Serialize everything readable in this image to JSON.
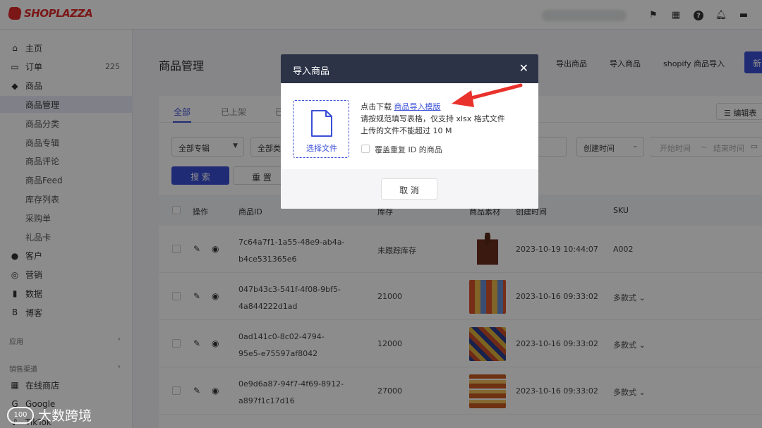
{
  "app": {
    "logo_text": "SHOPLAZZA"
  },
  "topbar": {
    "icons": [
      "flag-icon",
      "store-icon",
      "help-icon",
      "bell-icon",
      "message-icon"
    ]
  },
  "sidebar": {
    "items": [
      {
        "label": "主页",
        "icon": "home-icon"
      },
      {
        "label": "订单",
        "icon": "order-icon",
        "count": "225"
      },
      {
        "label": "商品",
        "icon": "tag-icon"
      },
      {
        "label": "商品管理",
        "sub": true,
        "active": true
      },
      {
        "label": "商品分类",
        "sub": true
      },
      {
        "label": "商品专辑",
        "sub": true
      },
      {
        "label": "商品评论",
        "sub": true
      },
      {
        "label": "商品Feed",
        "sub": true
      },
      {
        "label": "库存列表",
        "sub": true
      },
      {
        "label": "采购单",
        "sub": true
      },
      {
        "label": "礼品卡",
        "sub": true
      },
      {
        "label": "客户",
        "icon": "user-icon"
      },
      {
        "label": "营销",
        "icon": "marketing-icon"
      },
      {
        "label": "数据",
        "icon": "chart-icon"
      },
      {
        "label": "博客",
        "icon": "blog-icon"
      }
    ],
    "group_apps": "应用",
    "group_channels": "销售渠道",
    "channels": [
      {
        "label": "在线商店",
        "icon": "store-icon"
      },
      {
        "label": "Google",
        "icon": "google-icon"
      },
      {
        "label": "TikTok",
        "icon": "tiktok-icon"
      }
    ]
  },
  "main": {
    "title": "商品管理",
    "header_actions": [
      "导出商品",
      "导入商品",
      "shopify 商品导入"
    ],
    "new_button": "新",
    "tabs": [
      "全部",
      "已上架",
      "已"
    ],
    "edit_columns": "编辑表",
    "filters": {
      "album": "全部专辑",
      "category": "全部类",
      "sort": "创建时间",
      "start": "开始时间",
      "tilde": "~",
      "end": "结束时间"
    },
    "search": "搜 索",
    "reset": "重 置"
  },
  "table": {
    "headers": [
      "操作",
      "商品ID",
      "库存",
      "商品素材",
      "创建时间",
      "SKU"
    ],
    "rows": [
      {
        "id1": "7c64a7f1-1a55-48e9-ab4a-",
        "id2": "b4ce531365e6",
        "stock": "未跟踪库存",
        "time": "2023-10-19 10:44:07",
        "sku": "A002"
      },
      {
        "id1": "047b43c3-541f-4f08-9bf5-",
        "id2": "4a844222d1ad",
        "stock": "21000",
        "time": "2023-10-16 09:33:02",
        "sku": "多款式 ⌄"
      },
      {
        "id1": "0ad141c0-8c02-4794-",
        "id2": "95e5-e75597af8042",
        "stock": "12000",
        "time": "2023-10-16 09:33:02",
        "sku": "多款式 ⌄"
      },
      {
        "id1": "0e9d6a87-94f7-4f69-8912-",
        "id2": "a897f1c17d16",
        "stock": "27000",
        "time": "2023-10-16 09:33:02",
        "sku": "多款式 ⌄"
      }
    ]
  },
  "modal": {
    "title": "导入商品",
    "close": "✕",
    "select_file": "选择文件",
    "line1_prefix": "点击下载 ",
    "line1_link": "商品导入模版",
    "line2": "请按规范填写表格，仅支持 xlsx 格式文件",
    "line3": "上传的文件不能超过 10 M",
    "checkbox_label": "覆盖重复 ID 的商品",
    "cancel": "取 消"
  },
  "watermark": {
    "logo": "100",
    "text": "大数跨境"
  }
}
